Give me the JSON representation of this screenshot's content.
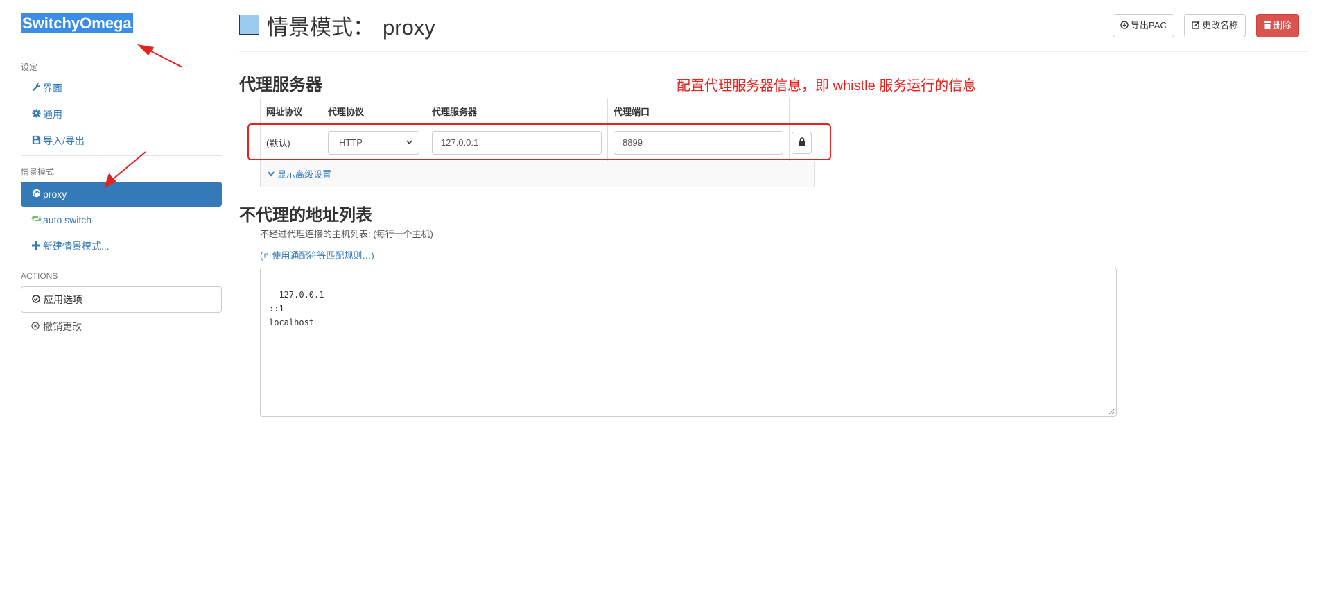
{
  "sidebar": {
    "brand": "SwitchyOmega",
    "settings_header": "设定",
    "settings_items": [
      {
        "label": "界面",
        "icon": "wrench-icon"
      },
      {
        "label": "通用",
        "icon": "gear-icon"
      },
      {
        "label": "导入/导出",
        "icon": "floppy-icon"
      }
    ],
    "profiles_header": "情景模式",
    "profiles": [
      {
        "label": "proxy",
        "icon": "globe-icon",
        "active": true
      },
      {
        "label": "auto switch",
        "icon": "retweet-icon",
        "active": false
      }
    ],
    "new_profile": "新建情景模式...",
    "actions_header": "ACTIONS",
    "apply_label": "应用选项",
    "discard_label": "撤销更改"
  },
  "header": {
    "title_prefix": "情景模式：",
    "profile_name": "proxy",
    "profile_color": "#99ccee",
    "export_pac": "导出PAC",
    "rename": "更改名称",
    "delete": "删除"
  },
  "proxy_section": {
    "title": "代理服务器",
    "annotation": "配置代理服务器信息，即 whistle 服务运行的信息",
    "columns": [
      "网址协议",
      "代理协议",
      "代理服务器",
      "代理端口"
    ],
    "row": {
      "scheme": "(默认)",
      "protocol": "HTTP",
      "server": "127.0.0.1",
      "port": "8899"
    },
    "advanced_toggle": "显示高级设置"
  },
  "bypass_section": {
    "title": "不代理的地址列表",
    "help": "不经过代理连接的主机列表: (每行一个主机)",
    "wildcard_link": "(可使用通配符等匹配规则…)",
    "list": "127.0.0.1\n::1\nlocalhost"
  },
  "colors": {
    "accent": "#337ab7",
    "danger": "#d9534f",
    "annotation": "#e4231f"
  }
}
